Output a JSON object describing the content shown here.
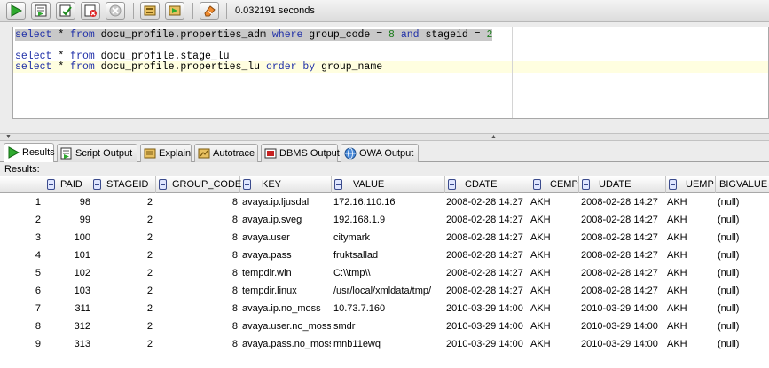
{
  "toolbar": {
    "buttons": [
      {
        "name": "run-statement-button",
        "icon": "play-icon"
      },
      {
        "name": "run-script-button",
        "icon": "script-icon"
      },
      {
        "name": "commit-button",
        "icon": "commit-icon"
      },
      {
        "name": "rollback-button",
        "icon": "rollback-icon"
      },
      {
        "name": "cancel-button",
        "icon": "cancel-icon"
      },
      {
        "name": "sql-history-button",
        "icon": "history-icon"
      },
      {
        "name": "explain-plan-button",
        "icon": "explain-icon"
      },
      {
        "name": "clear-button",
        "icon": "eraser-icon"
      }
    ],
    "timing": "0.032191 seconds"
  },
  "editor": {
    "lines": [
      {
        "tokens": [
          {
            "t": "select",
            "k": "kw"
          },
          {
            "t": " * "
          },
          {
            "t": "from",
            "k": "kw"
          },
          {
            "t": " docu_profile.properties_adm "
          },
          {
            "t": "where",
            "k": "kw"
          },
          {
            "t": " group_code = "
          },
          {
            "t": "8",
            "k": "num"
          },
          {
            "t": " "
          },
          {
            "t": "and",
            "k": "kw"
          },
          {
            "t": " stageid = "
          },
          {
            "t": "2",
            "k": "num"
          }
        ]
      },
      {
        "tokens": [
          {
            "t": "select",
            "k": "kw"
          },
          {
            "t": " * "
          },
          {
            "t": "from",
            "k": "kw"
          },
          {
            "t": " docu_profile.stage_lu"
          }
        ]
      },
      {
        "tokens": [
          {
            "t": "select",
            "k": "kw"
          },
          {
            "t": " * "
          },
          {
            "t": "from",
            "k": "kw"
          },
          {
            "t": " docu_profile.properties_lu "
          },
          {
            "t": "order",
            "k": "kw"
          },
          {
            "t": " "
          },
          {
            "t": "by",
            "k": "kw"
          },
          {
            "t": " group_name"
          }
        ]
      }
    ]
  },
  "tabs": [
    {
      "label": "Results",
      "icon": "results-icon",
      "active": true
    },
    {
      "label": "Script Output",
      "icon": "script-output-icon",
      "active": false
    },
    {
      "label": "Explain",
      "icon": "explain-icon",
      "active": false
    },
    {
      "label": "Autotrace",
      "icon": "autotrace-icon",
      "active": false
    },
    {
      "label": "DBMS Output",
      "icon": "dbms-output-icon",
      "active": false
    },
    {
      "label": "OWA Output",
      "icon": "owa-output-icon",
      "active": false
    }
  ],
  "results_label": "Results:",
  "grid": {
    "columns": [
      "PAID",
      "STAGEID",
      "GROUP_CODE",
      "KEY",
      "VALUE",
      "CDATE",
      "CEMP",
      "UDATE",
      "UEMP",
      "BIGVALUE"
    ],
    "rows": [
      [
        "1",
        "98",
        "2",
        "8",
        "avaya.ip.ljusdal",
        "172.16.110.16",
        "2008-02-28 14:27",
        "AKH",
        "2008-02-28 14:27",
        "AKH",
        "(null)"
      ],
      [
        "2",
        "99",
        "2",
        "8",
        "avaya.ip.sveg",
        "192.168.1.9",
        "2008-02-28 14:27",
        "AKH",
        "2008-02-28 14:27",
        "AKH",
        "(null)"
      ],
      [
        "3",
        "100",
        "2",
        "8",
        "avaya.user",
        "citymark",
        "2008-02-28 14:27",
        "AKH",
        "2008-02-28 14:27",
        "AKH",
        "(null)"
      ],
      [
        "4",
        "101",
        "2",
        "8",
        "avaya.pass",
        "fruktsallad",
        "2008-02-28 14:27",
        "AKH",
        "2008-02-28 14:27",
        "AKH",
        "(null)"
      ],
      [
        "5",
        "102",
        "2",
        "8",
        "tempdir.win",
        "C:\\\\tmp\\\\",
        "2008-02-28 14:27",
        "AKH",
        "2008-02-28 14:27",
        "AKH",
        "(null)"
      ],
      [
        "6",
        "103",
        "2",
        "8",
        "tempdir.linux",
        "/usr/local/xmldata/tmp/",
        "2008-02-28 14:27",
        "AKH",
        "2008-02-28 14:27",
        "AKH",
        "(null)"
      ],
      [
        "7",
        "311",
        "2",
        "8",
        "avaya.ip.no_moss",
        "10.73.7.160",
        "2010-03-29 14:00",
        "AKH",
        "2010-03-29 14:00",
        "AKH",
        "(null)"
      ],
      [
        "8",
        "312",
        "2",
        "8",
        "avaya.user.no_moss",
        "smdr",
        "2010-03-29 14:00",
        "AKH",
        "2010-03-29 14:00",
        "AKH",
        "(null)"
      ],
      [
        "9",
        "313",
        "2",
        "8",
        "avaya.pass.no_moss",
        "mnb11ewq",
        "2010-03-29 14:00",
        "AKH",
        "2010-03-29 14:00",
        "AKH",
        "(null)"
      ]
    ]
  }
}
